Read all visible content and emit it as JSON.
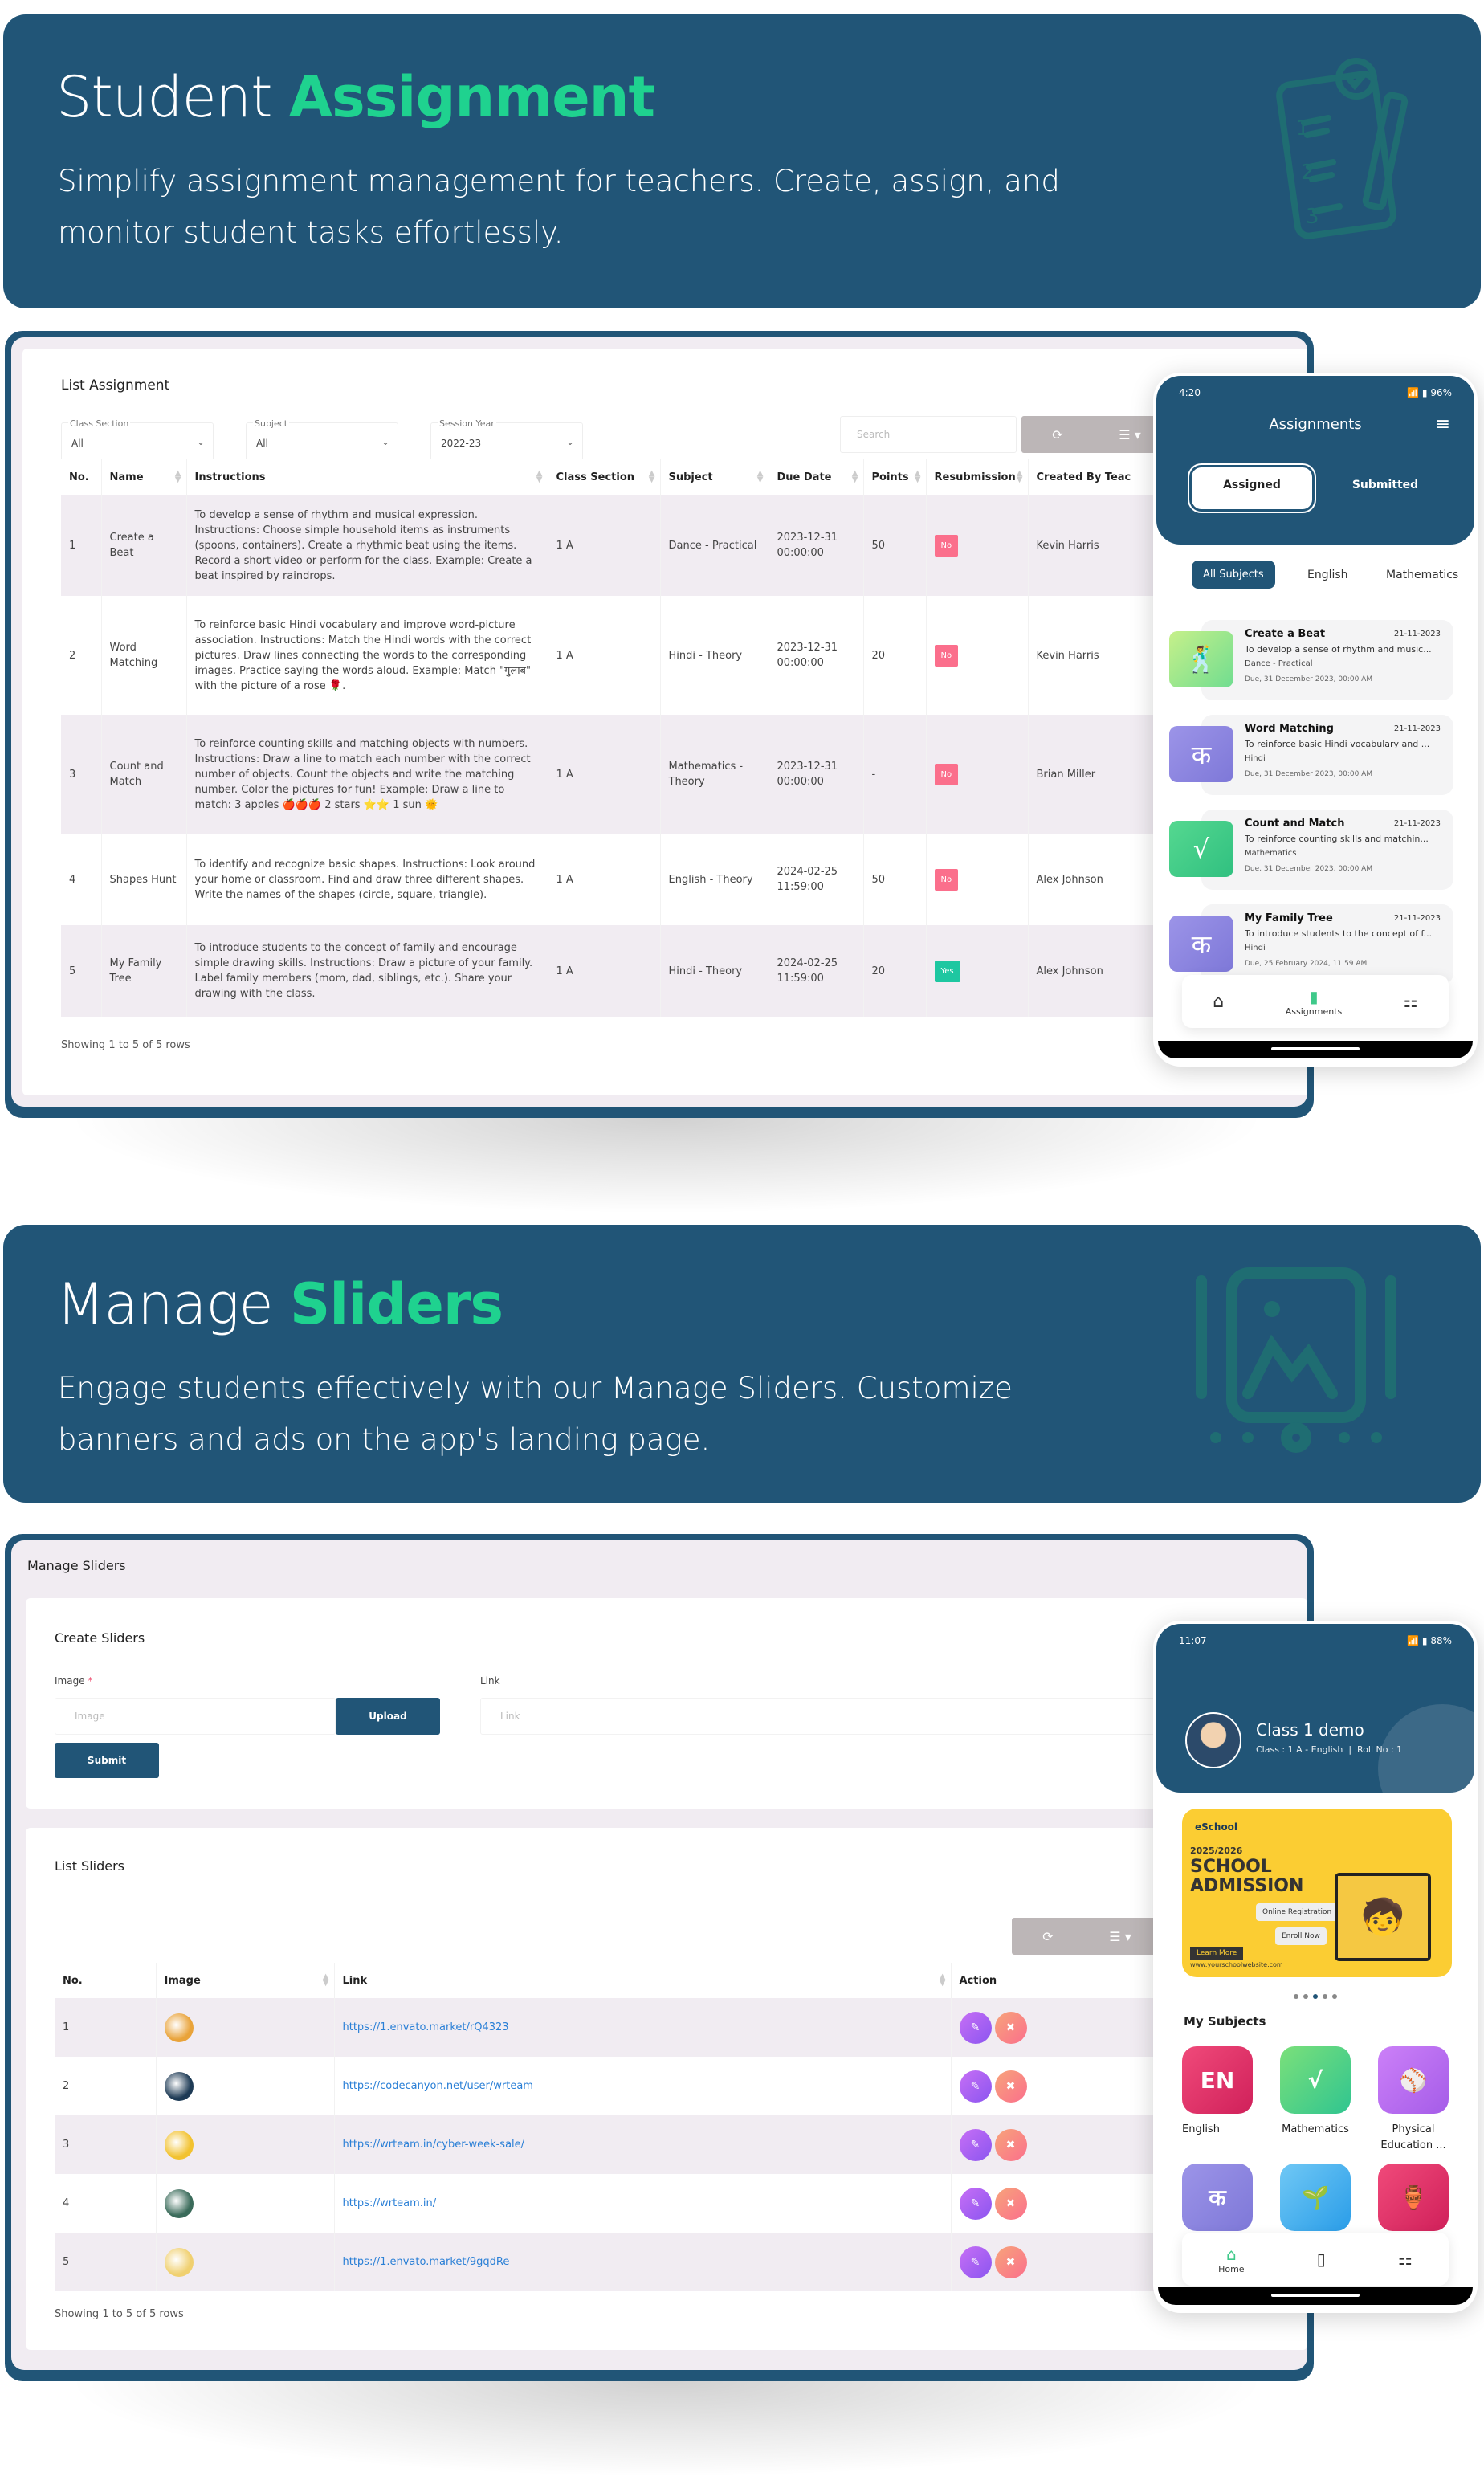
{
  "section1": {
    "title_plain": "Student",
    "title_accent": "Assignment",
    "description": "Simplify assignment management for teachers. Create, assign, and monitor student tasks effortlessly.",
    "decor_icon": "assignment-clipboard-icon"
  },
  "assignment_panel": {
    "title": "List Assignment",
    "filters": [
      {
        "label": "Class Section",
        "value": "All"
      },
      {
        "label": "Subject",
        "value": "All"
      },
      {
        "label": "Session Year",
        "value": "2022-23"
      }
    ],
    "search_placeholder": "Search",
    "columns": [
      "No.",
      "Name",
      "Instructions",
      "Class Section",
      "Subject",
      "Due Date",
      "Points",
      "Resubmission",
      "Created By Teac"
    ],
    "rows": [
      {
        "no": "1",
        "name": "Create a Beat",
        "instructions": "To develop a sense of rhythm and musical expression. Instructions: Choose simple household items as instruments (spoons, containers). Create a rhythmic beat using the items. Record a short video or perform for the class. Example: Create a beat inspired by raindrops.",
        "class_section": "1 A",
        "subject": "Dance - Practical",
        "due_date": "2023-12-31 00:00:00",
        "points": "50",
        "resubmission": "No",
        "created_by": "Kevin Harris"
      },
      {
        "no": "2",
        "name": "Word Matching",
        "instructions": "To reinforce basic Hindi vocabulary and improve word-picture association. Instructions: Match the Hindi words with the correct pictures. Draw lines connecting the words to the corresponding images. Practice saying the words aloud. Example: Match \"गुलाब\" with the picture of a rose 🌹.",
        "class_section": "1 A",
        "subject": "Hindi - Theory",
        "due_date": "2023-12-31 00:00:00",
        "points": "20",
        "resubmission": "No",
        "created_by": "Kevin Harris"
      },
      {
        "no": "3",
        "name": "Count and Match",
        "instructions": "To reinforce counting skills and matching objects with numbers. Instructions: Draw a line to match each number with the correct number of objects. Count the objects and write the matching number. Color the pictures for fun! Example: Draw a line to match: 3 apples 🍎🍎🍎 2 stars ⭐⭐ 1 sun 🌞",
        "class_section": "1 A",
        "subject": "Mathematics - Theory",
        "due_date": "2023-12-31 00:00:00",
        "points": "-",
        "resubmission": "No",
        "created_by": "Brian Miller"
      },
      {
        "no": "4",
        "name": "Shapes Hunt",
        "instructions": "To identify and recognize basic shapes. Instructions: Look around your home or classroom. Find and draw three different shapes. Write the names of the shapes (circle, square, triangle).",
        "class_section": "1 A",
        "subject": "English - Theory",
        "due_date": "2024-02-25 11:59:00",
        "points": "50",
        "resubmission": "No",
        "created_by": "Alex Johnson"
      },
      {
        "no": "5",
        "name": "My Family Tree",
        "instructions": "To introduce students to the concept of family and encourage simple drawing skills. Instructions: Draw a picture of your family. Label family members (mom, dad, siblings, etc.). Share your drawing with the class.",
        "class_section": "1 A",
        "subject": "Hindi - Theory",
        "due_date": "2024-02-25 11:59:00",
        "points": "20",
        "resubmission": "Yes",
        "created_by": "Alex Johnson"
      }
    ],
    "showing": "Showing 1 to 5 of 5 rows"
  },
  "phone1": {
    "time": "4:20",
    "battery": "96%",
    "title": "Assignments",
    "tabs": [
      "Assigned",
      "Submitted"
    ],
    "active_tab": "Assigned",
    "chips": [
      "All Subjects",
      "English",
      "Mathematics"
    ],
    "active_chip": "All Subjects",
    "items": [
      {
        "title": "Create a Beat",
        "date": "21-11-2023",
        "summary": "To develop a sense of rhythm and music...",
        "subject": "Dance - Practical",
        "due": "Due, 31 December 2023, 00:00 AM",
        "icon": "dance-icon",
        "color": "#8fe08a"
      },
      {
        "title": "Word Matching",
        "date": "21-11-2023",
        "summary": "To reinforce basic Hindi vocabulary and ...",
        "subject": "Hindi",
        "due": "Due, 31 December 2023, 00:00 AM",
        "icon": "hindi-book-icon",
        "color": "#8a85e0"
      },
      {
        "title": "Count and Match",
        "date": "21-11-2023",
        "summary": "To reinforce counting skills and matchin...",
        "subject": "Mathematics",
        "due": "Due, 31 December 2023, 00:00 AM",
        "icon": "math-book-icon",
        "color": "#40c98a"
      },
      {
        "title": "My Family Tree",
        "date": "21-11-2023",
        "summary": "To introduce students to the concept of f...",
        "subject": "Hindi",
        "due": "Due, 25 February 2024, 11:59 AM",
        "icon": "hindi-book-icon",
        "color": "#8a85e0"
      }
    ],
    "nav": [
      "",
      "Assignments",
      ""
    ]
  },
  "section2": {
    "title_plain": "Manage",
    "title_accent": "Sliders",
    "description": "Engage students effectively with our Manage Sliders. Customize banners and ads on the app's landing page.",
    "decor_icon": "image-slider-icon"
  },
  "sliders_panel": {
    "page_title": "Manage Sliders",
    "create_title": "Create Sliders",
    "image_label": "Image",
    "image_required": "*",
    "image_placeholder": "Image",
    "upload_label": "Upload",
    "link_label": "Link",
    "link_placeholder": "Link",
    "submit_label": "Submit",
    "list_title": "List Sliders",
    "columns": [
      "No.",
      "Image",
      "Link",
      "Action"
    ],
    "rows": [
      {
        "no": "1",
        "link": "https://1.envato.market/rQ4323",
        "thumb_color": "#e9a33a"
      },
      {
        "no": "2",
        "link": "https://codecanyon.net/user/wrteam",
        "thumb_color": "#1d3a55"
      },
      {
        "no": "3",
        "link": "https://wrteam.in/cyber-week-sale/",
        "thumb_color": "#f2c230"
      },
      {
        "no": "4",
        "link": "https://wrteam.in/",
        "thumb_color": "#3a6b5a"
      },
      {
        "no": "5",
        "link": "https://1.envato.market/9gqdRe",
        "thumb_color": "#f0d070"
      }
    ],
    "showing": "Showing 1 to 5 of 5 rows"
  },
  "phone2": {
    "time": "11:07",
    "battery": "88%",
    "student_name": "Class 1 demo",
    "student_meta": "Class : 1 A - English  |  Roll No : 1",
    "banner": {
      "brand": "eSchool",
      "year": "2025/2026",
      "headline1": "SCHOOL",
      "headline2": "ADMISSION",
      "cta1": "Online Registration",
      "cta2": "Enroll Now",
      "learn_more": "Learn More",
      "website": "www.yourschoolwebsite.com"
    },
    "carousel_count": 5,
    "carousel_active": 3,
    "subjects_title": "My Subjects",
    "subjects": [
      {
        "label": "English",
        "glyph": "EN",
        "color": "#e23a6a"
      },
      {
        "label": "Mathematics",
        "glyph": "√",
        "color": "#3fd08a"
      },
      {
        "label": "Physical Education ...",
        "glyph": "⚾",
        "color": "#b56cf0"
      },
      {
        "label": "",
        "glyph": "क",
        "color": "#8c82e0"
      },
      {
        "label": "",
        "glyph": "🌱",
        "color": "#3fa7ea"
      },
      {
        "label": "",
        "glyph": "🏺",
        "color": "#e03565"
      }
    ],
    "nav": [
      "Home",
      "",
      ""
    ]
  }
}
